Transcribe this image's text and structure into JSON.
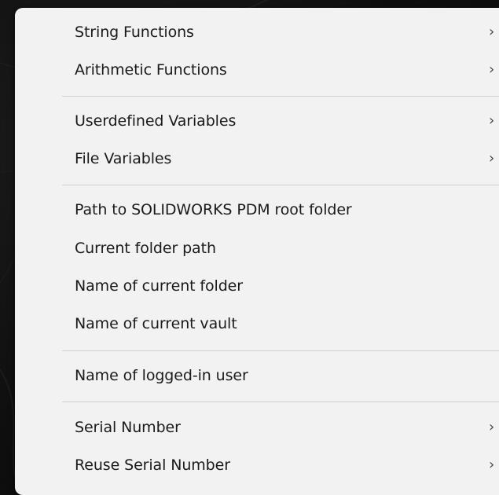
{
  "menu": {
    "items": [
      {
        "label": "String Functions",
        "submenu_glyph": "›"
      },
      {
        "label": "Arithmetic Functions",
        "submenu_glyph": "›"
      },
      {
        "label": "Userdefined Variables",
        "submenu_glyph": "›"
      },
      {
        "label": "File Variables",
        "submenu_glyph": "›"
      },
      {
        "label": "Path to SOLIDWORKS PDM root folder"
      },
      {
        "label": "Current folder path"
      },
      {
        "label": "Name of current folder"
      },
      {
        "label": "Name of current vault"
      },
      {
        "label": "Name of logged-in user"
      },
      {
        "label": "Serial Number",
        "submenu_glyph": "›"
      },
      {
        "label": "Reuse Serial Number",
        "submenu_glyph": "›"
      }
    ]
  },
  "colors": {
    "menu_background": "#f2f2f2",
    "separator": "#d0d0d0",
    "text": "#1a1a1a",
    "desktop": "#0e0e0e"
  }
}
